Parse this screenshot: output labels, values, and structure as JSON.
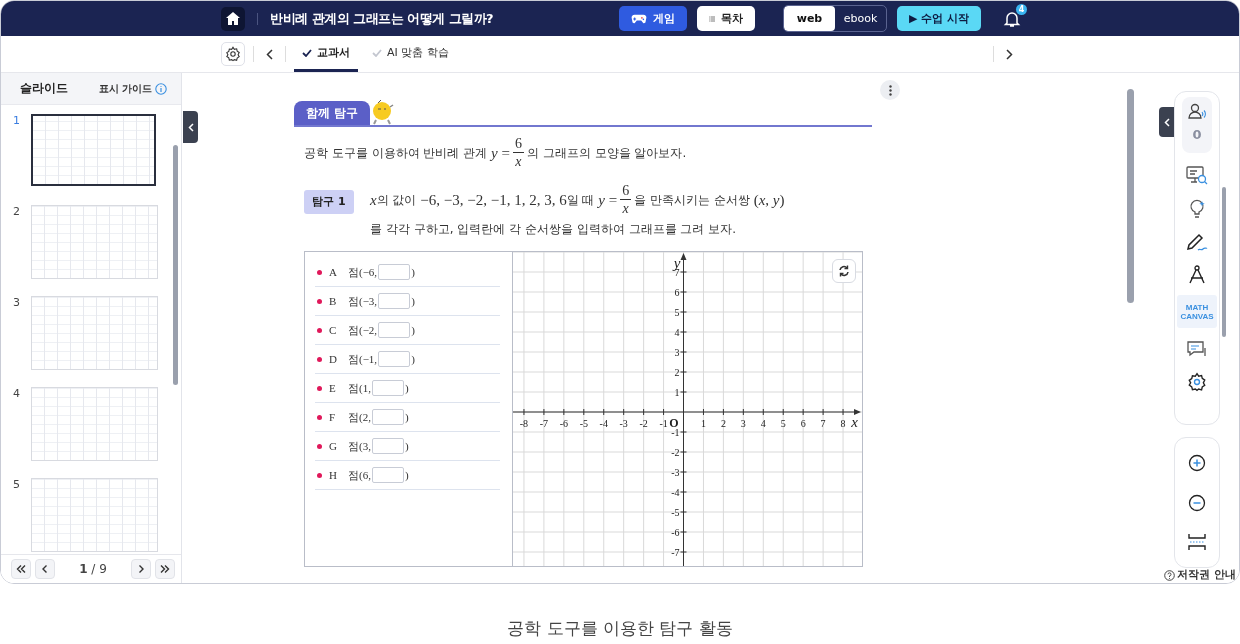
{
  "top_bar": {
    "title": "반비례 관계의 그래프는 어떻게 그릴까?",
    "buttons": [
      {
        "kind": "game",
        "label": "게임"
      },
      {
        "kind": "toc",
        "label": "목차"
      }
    ],
    "view_toggle": [
      {
        "label": "web",
        "selected": true
      },
      {
        "label": "ebook",
        "selected": false
      }
    ],
    "start_button": "▶ 수업 시작",
    "notification_count": "4"
  },
  "tabs": [
    {
      "label": "교과서",
      "selected": true
    },
    {
      "label": "AI 맞춤 학습",
      "selected": false
    }
  ],
  "sidebar": {
    "title": "슬라이드",
    "guide_link": "표시 가이드",
    "slides": [
      {
        "number": "1",
        "selected": true
      },
      {
        "number": "2",
        "selected": false
      },
      {
        "number": "3",
        "selected": false
      },
      {
        "number": "4",
        "selected": false
      },
      {
        "number": "5",
        "selected": false
      }
    ],
    "page_indicator": "**1** / 9"
  },
  "content": {
    "section_label": "함께 탐구",
    "intro": [
      {
        "kind": "text",
        "text": "공학 도구를 이용하여 반비례 관계 "
      },
      {
        "kind": "math",
        "text": "*y* ="
      },
      {
        "kind": "frac",
        "num": "6",
        "den": "*x*"
      },
      {
        "kind": "text",
        "text": "의 그래프의 모양을 알아보자."
      }
    ],
    "activity": {
      "badge": "탐구 1",
      "text": [
        {
          "kind": "math",
          "text": "*x*"
        },
        {
          "kind": "text",
          "text": "의 값이 "
        },
        {
          "kind": "math",
          "text": "−6, −3, −2, −1, 1, 2, 3, 6"
        },
        {
          "kind": "text",
          "text": "일 때 "
        },
        {
          "kind": "math",
          "text": "*y* ="
        },
        {
          "kind": "frac",
          "num": "6",
          "den": "*x*"
        },
        {
          "kind": "text",
          "text": "을 만족시키는 순서쌍 "
        },
        {
          "kind": "math",
          "text": "(*x*, *y*)"
        },
        {
          "kind": "text",
          "text": "를 각각 구하고, 입력란에 각 순서쌍을 입력하여 그래프를 그려 보자."
        }
      ]
    },
    "points": [
      {
        "label": "A",
        "prefix": "점(−6,",
        "suffix": ")"
      },
      {
        "label": "B",
        "prefix": "점(−3,",
        "suffix": ")"
      },
      {
        "label": "C",
        "prefix": "점(−2,",
        "suffix": ")"
      },
      {
        "label": "D",
        "prefix": "점(−1,",
        "suffix": ")"
      },
      {
        "label": "E",
        "prefix": "점(1,",
        "suffix": ")"
      },
      {
        "label": "F",
        "prefix": "점(2,",
        "suffix": ")"
      },
      {
        "label": "G",
        "prefix": "점(3,",
        "suffix": ")"
      },
      {
        "label": "H",
        "prefix": "점(6,",
        "suffix": ")"
      }
    ],
    "graph": {
      "origin_label": "O",
      "chart_data": {
        "type": "scatter",
        "grid": true,
        "xlabel": "x",
        "ylabel": "y",
        "xlim": [
          -8.55,
          8.95
        ],
        "ylim": [
          -7.7,
          8
        ],
        "xticks": [
          {
            "value": -8,
            "label": "-8"
          },
          {
            "value": -7,
            "label": "-7"
          },
          {
            "value": -6,
            "label": "-6"
          },
          {
            "value": -5,
            "label": "-5"
          },
          {
            "value": -4,
            "label": "-4"
          },
          {
            "value": -3,
            "label": "-3"
          },
          {
            "value": -2,
            "label": "-2"
          },
          {
            "value": -1,
            "label": "-1"
          },
          1,
          2,
          3,
          4,
          5,
          6,
          7,
          8
        ],
        "yticks": [
          7,
          6,
          5,
          4,
          3,
          2,
          1,
          {
            "value": -1,
            "label": "-1"
          },
          {
            "value": -2,
            "label": "-2"
          },
          {
            "value": -3,
            "label": "-3"
          },
          {
            "value": -4,
            "label": "-4"
          },
          {
            "value": -5,
            "label": "-5"
          },
          {
            "value": -6,
            "label": "-6"
          },
          {
            "value": -7,
            "label": "-7"
          }
        ]
      }
    }
  },
  "right_toolbar": {
    "participant_count": "0",
    "math_canvas": "MATH CANVAS"
  },
  "copyright_link": "저작권 안내",
  "caption": "공학 도구를 이용한 탐구 활동"
}
